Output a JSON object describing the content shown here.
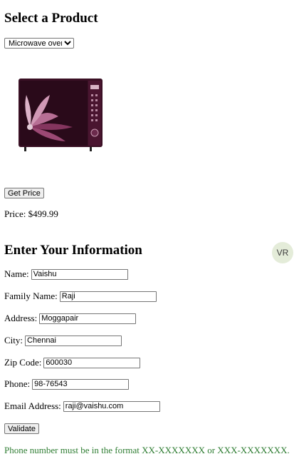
{
  "product_section": {
    "title": "Select a Product",
    "selected_product": "Microwave oven",
    "product_image_alt": "Microwave oven",
    "get_price_label": "Get Price",
    "price_text": "Price: $499.99"
  },
  "info_section": {
    "title": "Enter Your Information",
    "avatar_initials": "VR",
    "fields": [
      {
        "label": "Name:",
        "value": "Vaishu"
      },
      {
        "label": "Family Name:",
        "value": "Raji"
      },
      {
        "label": "Address:",
        "value": "Moggapair"
      },
      {
        "label": "City:",
        "value": "Chennai"
      },
      {
        "label": "Zip Code:",
        "value": "600030"
      },
      {
        "label": "Phone:",
        "value": "98-76543"
      },
      {
        "label": "Email Address:",
        "value": "raji@vaishu.com"
      }
    ],
    "validate_label": "Validate",
    "validation_message": "Phone number must be in the format XX-XXXXXXX or XXX-XXXXXXX."
  },
  "colors": {
    "message": "#2e7d32",
    "avatar_bg": "#e4ecd9"
  }
}
